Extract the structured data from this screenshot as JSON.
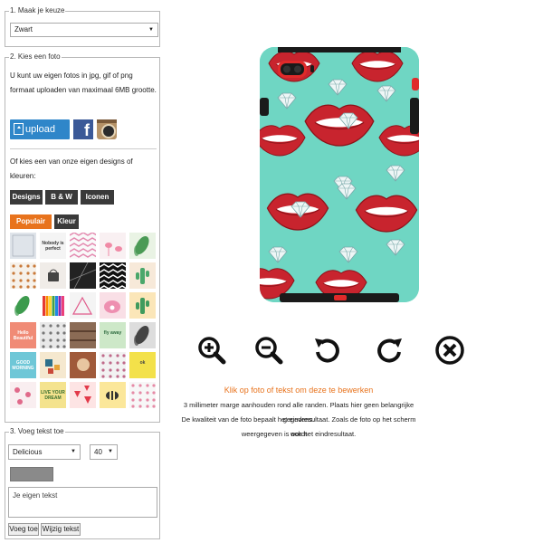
{
  "step1": {
    "legend": "1. Maak je keuze",
    "select_value": "Zwart"
  },
  "step2": {
    "legend": "2. Kies een foto",
    "description": "U kunt uw eigen fotos in jpg, gif of png formaat uploaden van maximaal 6MB grootte.",
    "upload_label": "upload",
    "facebook_glyph": "f",
    "own_designs_text": "Of kies een van onze eigen designs of kleuren:",
    "tabs": [
      "Designs",
      "B & W",
      "Iconen"
    ],
    "subtabs": [
      "Populair",
      "Kleur"
    ],
    "thumbnails": [
      {
        "kind": "texture",
        "bg": "#dfe4ea",
        "fg": "#9aa3ad"
      },
      {
        "kind": "text",
        "bg": "#f4f4f4",
        "fg": "#333",
        "text": "Nobody is perfect"
      },
      {
        "kind": "stripes",
        "bg": "#f9f9f9",
        "fg": "#e48ab0"
      },
      {
        "kind": "flamingo",
        "bg": "#f9f0f2",
        "fg": "#f08aa6"
      },
      {
        "kind": "leaf",
        "bg": "#e9f3e4",
        "fg": "#4a9a55"
      },
      {
        "kind": "dots",
        "bg": "#f6f1ea",
        "fg": "#c97a3a"
      },
      {
        "kind": "bag",
        "bg": "#f0ece8",
        "fg": "#444"
      },
      {
        "kind": "marble",
        "bg": "#222",
        "fg": "#888"
      },
      {
        "kind": "zigzag",
        "bg": "#111",
        "fg": "#fff"
      },
      {
        "kind": "cactus",
        "bg": "#f7e9d9",
        "fg": "#4aa76a"
      },
      {
        "kind": "plant",
        "bg": "#fff",
        "fg": "#3d9b4e"
      },
      {
        "kind": "rainbow",
        "bg": "#fff",
        "fg": "#f00"
      },
      {
        "kind": "tri",
        "bg": "#f4f4f4",
        "fg": "#e05a8a"
      },
      {
        "kind": "pig",
        "bg": "#f9dfe6",
        "fg": "#ee8fb0"
      },
      {
        "kind": "cactus2",
        "bg": "#fbe6b8",
        "fg": "#3f9b5d"
      },
      {
        "kind": "text",
        "bg": "#f08b76",
        "fg": "#fff",
        "text": "Hello Beautiful"
      },
      {
        "kind": "dots",
        "bg": "#e8e8e8",
        "fg": "#777"
      },
      {
        "kind": "wood",
        "bg": "#8b6b55",
        "fg": "#5c4030"
      },
      {
        "kind": "text",
        "bg": "#cde8c8",
        "fg": "#2e6b3f",
        "text": "fly away"
      },
      {
        "kind": "leaf2",
        "bg": "#ddd",
        "fg": "#444"
      },
      {
        "kind": "text",
        "bg": "#6ec7d7",
        "fg": "#fff",
        "text": "GOOD MORNING"
      },
      {
        "kind": "blocks",
        "bg": "#f5e8cf",
        "fg": "#2d6f8a"
      },
      {
        "kind": "photo",
        "bg": "#a05a3a",
        "fg": "#e8c6a0"
      },
      {
        "kind": "dots",
        "bg": "#f2f2f2",
        "fg": "#c06a8a"
      },
      {
        "kind": "text",
        "bg": "#f3e14a",
        "fg": "#444",
        "text": "ok"
      },
      {
        "kind": "flowers",
        "bg": "#f9eef0",
        "fg": "#e06a8a"
      },
      {
        "kind": "text",
        "bg": "#f4e38e",
        "fg": "#3a6f2f",
        "text": "LIVE YOUR DREAM"
      },
      {
        "kind": "watermelon",
        "bg": "#fde4e4",
        "fg": "#e23a4a"
      },
      {
        "kind": "bee",
        "bg": "#fbe79a",
        "fg": "#333"
      },
      {
        "kind": "dots",
        "bg": "#f7f7f7",
        "fg": "#e68aa6"
      }
    ]
  },
  "step3": {
    "legend": "3. Voeg tekst toe",
    "font_select": "Delicious",
    "size_select": "40",
    "color": "#8a8a8a",
    "text_placeholder": "Je eigen tekst",
    "add_button": "Voeg toe",
    "edit_button": "Wijzig tekst"
  },
  "phone": {
    "bg_color": "#6fd6c3",
    "lip_color": "#c8242e",
    "case_accent": "#d32f2f"
  },
  "controls": [
    {
      "name": "zoom-in-icon"
    },
    {
      "name": "zoom-out-icon"
    },
    {
      "name": "rotate-left-icon"
    },
    {
      "name": "rotate-right-icon"
    },
    {
      "name": "remove-icon"
    }
  ],
  "editor": {
    "hint": "Klik op foto of tekst om deze te bewerken",
    "info_lines": [
      "3 millimeter marge aanhouden rond alle randen. Plaats hier geen belangrijke gegevens.",
      "De kwaliteit van de foto bepaalt het eindresultaat. Zoals de foto op het scherm wordt",
      "weergegeven is ook het eindresultaat."
    ]
  }
}
